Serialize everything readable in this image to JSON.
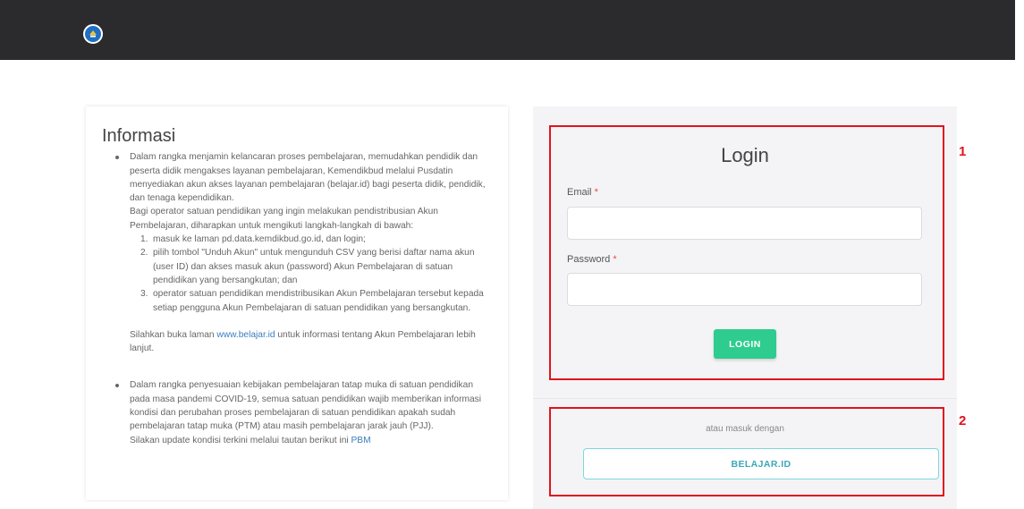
{
  "header": {
    "logo_icon": "tut-wuri-handayani-logo-icon",
    "background": "#2b2b2d"
  },
  "info": {
    "title": "Informasi",
    "item1": {
      "paragraph1": "Dalam rangka menjamin kelancaran proses pembelajaran, memudahkan pendidik dan peserta didik mengakses layanan pembelajaran, Kemendikbud melalui Pusdatin menyediakan akun akses layanan pembelajaran (belajar.id) bagi peserta didik, pendidik, dan tenaga kependidikan.",
      "paragraph2": "Bagi operator satuan pendidikan yang ingin melakukan pendistribusian Akun Pembelajaran, diharapkan untuk mengikuti langkah-langkah di bawah:",
      "steps": [
        {
          "num": "1.",
          "text": "masuk ke laman pd.data.kemdikbud.go.id, dan login;"
        },
        {
          "num": "2.",
          "text": "pilih tombol \"Unduh Akun\" untuk mengunduh CSV yang berisi daftar nama akun (user ID) dan akses masuk akun (password) Akun Pembelajaran di satuan pendidikan yang bersangkutan; dan"
        },
        {
          "num": "3.",
          "text": "operator satuan pendidikan mendistribusikan Akun Pembelajaran tersebut kepada setiap pengguna Akun Pembelajaran di satuan pendidikan yang bersangkutan."
        }
      ],
      "closing_before": "Silahkan buka laman ",
      "closing_link": "www.belajar.id",
      "closing_after": " untuk informasi tentang Akun Pembelajaran lebih lanjut."
    },
    "item2": {
      "paragraph1": "Dalam rangka penyesuaian kebijakan pembelajaran tatap muka di satuan pendidikan pada masa pandemi COVID-19, semua satuan pendidikan wajib memberikan informasi kondisi dan perubahan proses pembelajaran di satuan pendidikan apakah sudah pembelajaran tatap muka (PTM) atau masih pembelajaran jarak jauh (PJJ).",
      "paragraph2_before": "Silakan update kondisi terkini melalui tautan berikut ini ",
      "paragraph2_link": "PBM"
    }
  },
  "login": {
    "title": "Login",
    "email_label": "Email",
    "password_label": "Password",
    "required_mark": "*",
    "email_value": "",
    "password_value": "",
    "submit_label": "LOGIN",
    "alt_text": "atau masuk dengan",
    "belajar_label": "BELAJAR.ID"
  },
  "annotations": [
    {
      "label": "1"
    },
    {
      "label": "2"
    }
  ],
  "colors": {
    "accent_green": "#2ecc8f",
    "required_red": "#e74c3c",
    "annotation_red": "#e0141e",
    "link_blue": "#3a7ebf",
    "belajar_teal": "#3aa8b8"
  }
}
